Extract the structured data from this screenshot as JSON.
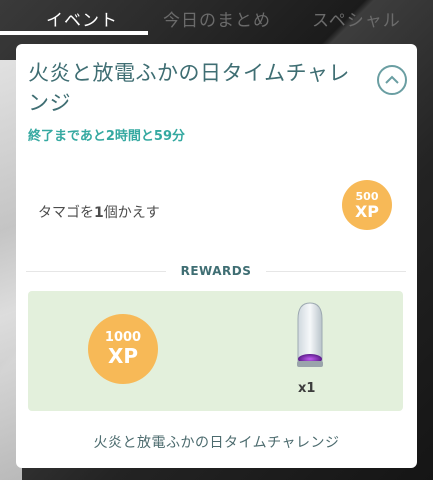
{
  "tabs": [
    {
      "label": "イベント",
      "active": true
    },
    {
      "label": "今日のまとめ",
      "active": false
    },
    {
      "label": "スペシャル",
      "active": false
    }
  ],
  "challenge": {
    "title": "火炎と放電ふかの日タイムチャレンジ",
    "time_left": "終了まであと2時間と59分",
    "task": {
      "text_before": "タマゴを",
      "text_bold": "1",
      "text_after": "個かえす",
      "xp_value": "500",
      "xp_unit": "XP"
    },
    "rewards_label": "REWARDS",
    "rewards": [
      {
        "type": "xp",
        "value": "1000",
        "unit": "XP"
      },
      {
        "type": "item",
        "icon": "incense-icon",
        "quantity": "x1"
      }
    ],
    "footer": "火炎と放電ふかの日タイムチャレンジ"
  },
  "colors": {
    "title": "#3f6e73",
    "time_left": "#35a9a1",
    "xp_badge": "#f7b957",
    "reward_box": "#e3f0dc"
  }
}
